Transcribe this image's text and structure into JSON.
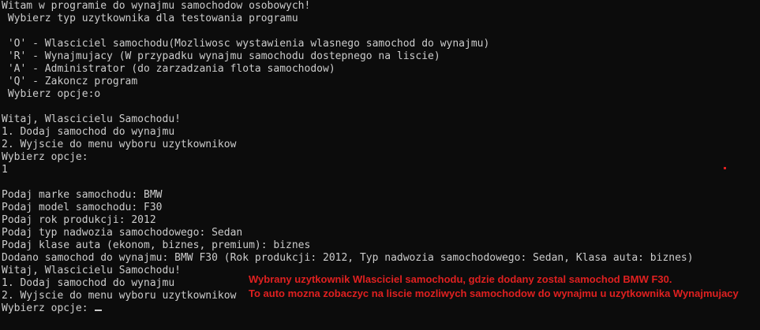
{
  "console": {
    "lines": [
      "Witam w programie do wynajmu samochodow osobowych!",
      " Wybierz typ uzytkownika dla testowania programu",
      "",
      " 'O' - Wlasciciel samochodu(Mozliwosc wystawienia wlasnego samochod do wynajmu)",
      " 'R' - Wynajmujacy (W przypadku wynajmu samochodu dostepnego na liscie)",
      " 'A' - Administrator (do zarzadzania flota samochodow)",
      " 'Q' - Zakoncz program",
      " Wybierz opcje:o",
      "",
      "Witaj, Wlascicielu Samochodu!",
      "1. Dodaj samochod do wynajmu",
      "2. Wyjscie do menu wyboru uzytkownikow",
      "Wybierz opcje:",
      "1",
      "",
      "Podaj marke samochodu: BMW",
      "Podaj model samochodu: F30",
      "Podaj rok produkcji: 2012",
      "Podaj typ nadwozia samochodowego: Sedan",
      "Podaj klase auta (ekonom, biznes, premium): biznes",
      "Dodano samochod do wynajmu: BMW F30 (Rok produkcji: 2012, Typ nadwozia samochodowego: Sedan, Klasa auta: biznes)",
      "Witaj, Wlascicielu Samochodu!",
      "1. Dodaj samochod do wynajmu",
      "2. Wyjscie do menu wyboru uzytkownikow",
      "Wybierz opcje: "
    ]
  },
  "annotation": {
    "line1": "Wybrany uzytkownik Wlasciciel samochodu, gdzie dodany zostal samochod BMW F30.",
    "line2": "To auto mozna zobaczyc na liscie mozliwych samochodow do wynajmu u uzytkownika Wynajmujacy"
  },
  "colors": {
    "background": "#0c0c0c",
    "text": "#cccccc",
    "annotation": "#e02020"
  }
}
